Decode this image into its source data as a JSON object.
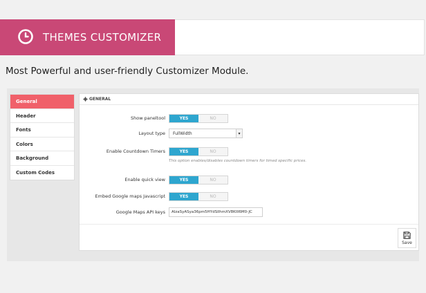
{
  "banner": {
    "title": "THEMES CUSTOMIZER",
    "icon": "clock-icon"
  },
  "tagline": "Most Powerful and user-friendly Customizer Module.",
  "sidebar": {
    "items": [
      {
        "label": "General",
        "active": true
      },
      {
        "label": "Header"
      },
      {
        "label": "Fonts"
      },
      {
        "label": "Colors"
      },
      {
        "label": "Background"
      },
      {
        "label": "Custom Codes"
      }
    ]
  },
  "section": {
    "title": "GENERAL",
    "icon": "gear-icon"
  },
  "form": {
    "show_paneltool": {
      "label": "Show paneltool",
      "yes": "YES",
      "no": "NO"
    },
    "layout_type": {
      "label": "Layout type",
      "value": "FullWidth"
    },
    "countdown": {
      "label": "Enable Countdown Timers",
      "yes": "YES",
      "no": "NO",
      "help": "This option enables/disables countdown timers for timed specific prices."
    },
    "quick_view": {
      "label": "Enable quick view",
      "yes": "YES",
      "no": "NO"
    },
    "google_maps_js": {
      "label": "Embed Google maps Javascript",
      "yes": "YES",
      "no": "NO"
    },
    "maps_api_key": {
      "label": "Google Maps API keys",
      "value": "AIzaSyASya36pm5HYdSIlhmXV8KIll6M0-JC"
    }
  },
  "save": {
    "label": "Save"
  },
  "colors": {
    "banner": "#c94876",
    "active_tab": "#f0606a",
    "toggle_on": "#2ea6cf"
  }
}
